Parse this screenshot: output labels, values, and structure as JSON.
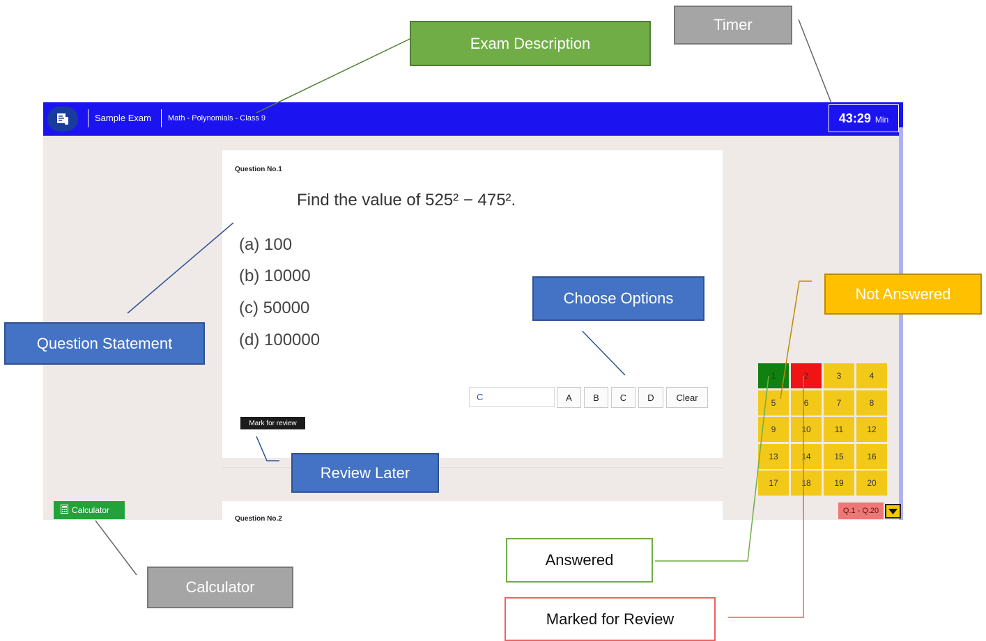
{
  "header": {
    "exam_name": "Sample Exam",
    "exam_description": "Math - Polynomials - Class 9",
    "timer_value": "43:29",
    "timer_unit": "Min"
  },
  "question1": {
    "label": "Question No.1",
    "statement": "Find the value of 525² − 475².",
    "options": [
      "(a) 100",
      "(b) 10000",
      "(c) 50000",
      "(d) 100000"
    ],
    "answer_value": "C",
    "option_buttons": [
      "A",
      "B",
      "C",
      "D"
    ],
    "clear_label": "Clear",
    "mark_review_label": "Mark for review"
  },
  "question2": {
    "label": "Question No.2"
  },
  "calculator": {
    "label": "Calculator"
  },
  "palette": {
    "questions": [
      {
        "n": "1",
        "status": "answered"
      },
      {
        "n": "2",
        "status": "review"
      },
      {
        "n": "3",
        "status": "not-answered"
      },
      {
        "n": "4",
        "status": "not-answered"
      },
      {
        "n": "5",
        "status": "not-answered"
      },
      {
        "n": "6",
        "status": "not-answered"
      },
      {
        "n": "7",
        "status": "not-answered"
      },
      {
        "n": "8",
        "status": "not-answered"
      },
      {
        "n": "9",
        "status": "not-answered"
      },
      {
        "n": "10",
        "status": "not-answered"
      },
      {
        "n": "11",
        "status": "not-answered"
      },
      {
        "n": "12",
        "status": "not-answered"
      },
      {
        "n": "13",
        "status": "not-answered"
      },
      {
        "n": "14",
        "status": "not-answered"
      },
      {
        "n": "15",
        "status": "not-answered"
      },
      {
        "n": "16",
        "status": "not-answered"
      },
      {
        "n": "17",
        "status": "not-answered"
      },
      {
        "n": "18",
        "status": "not-answered"
      },
      {
        "n": "19",
        "status": "not-answered"
      },
      {
        "n": "20",
        "status": "not-answered"
      }
    ],
    "status_colors": {
      "answered": "#108010",
      "review": "#ef1515",
      "not-answered": "#f2c919"
    },
    "range_label": "Q.1 - Q.20"
  },
  "callouts": {
    "exam_description": "Exam Description",
    "timer": "Timer",
    "question_statement": "Question Statement",
    "choose_options": "Choose Options",
    "not_answered": "Not Answered",
    "review_later": "Review Later",
    "calculator": "Calculator",
    "answered": "Answered",
    "marked_for_review": "Marked for Review"
  },
  "colors": {
    "header_bg": "#1c14f0",
    "content_bg": "#efe9e8",
    "calculator_green": "#22a33a"
  },
  "icons": {
    "logo": "exam-paper-icon",
    "calculator": "calculator-icon",
    "range_toggle": "caret-down-icon"
  }
}
